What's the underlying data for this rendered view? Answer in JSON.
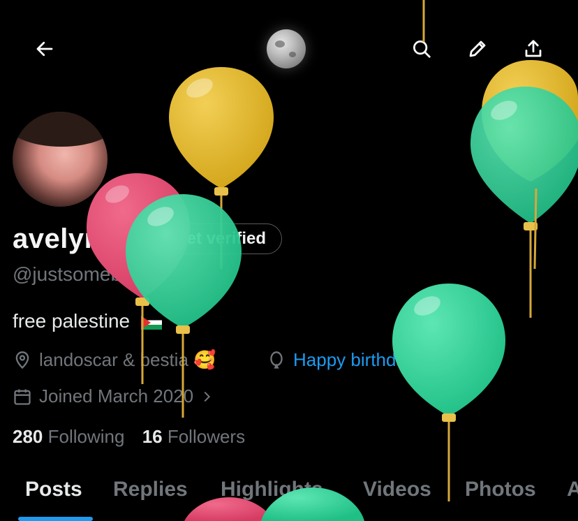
{
  "header": {
    "back_icon": "back-arrow-icon",
    "search_icon": "search-icon",
    "edit_icon": "pencil-icon",
    "share_icon": "share-icon"
  },
  "profile": {
    "name": "avelyn",
    "verify_label": "Get verified",
    "handle": "@justsomebody",
    "bio": "free palestine",
    "location": "landoscar & bestia 🥰",
    "birthday": "Happy birthday!",
    "joined": "Joined March 2020",
    "following_count": "280",
    "following_label": "Following",
    "followers_count": "16",
    "followers_label": "Followers"
  },
  "tabs": [
    {
      "label": "Posts"
    },
    {
      "label": "Replies"
    },
    {
      "label": "Highlights"
    },
    {
      "label": "Videos"
    },
    {
      "label": "Photos"
    },
    {
      "label": "A"
    }
  ],
  "colors": {
    "accent": "#1d9bf0",
    "balloon_yellow": "#e0b526",
    "balloon_green": "#2fd39a",
    "balloon_red": "#e0496e"
  }
}
